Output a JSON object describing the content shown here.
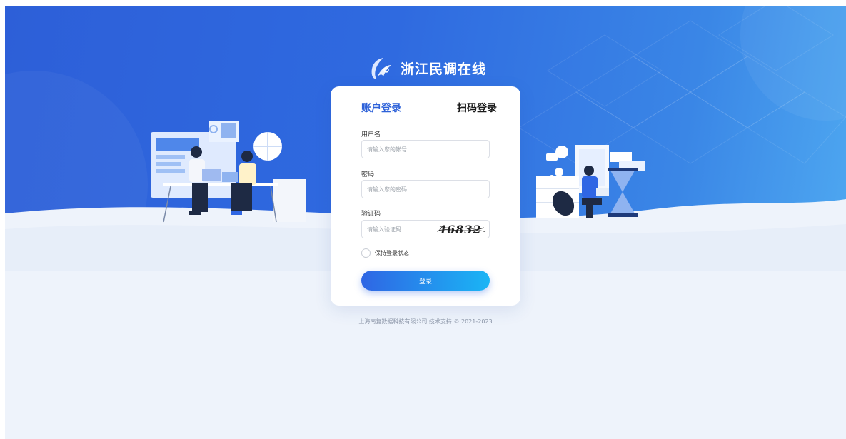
{
  "brand": {
    "name": "浙江民调在线",
    "logo_icon": "crescent-swoosh-logo-icon"
  },
  "tabs": {
    "account": "账户登录",
    "scan": "扫码登录"
  },
  "form": {
    "username_label": "用户名",
    "username_placeholder": "请输入您的帐号",
    "password_label": "密码",
    "password_placeholder": "请输入您的密码",
    "captcha_label": "验证码",
    "captcha_placeholder": "请输入验证码",
    "captcha_text": "46832",
    "remember_label": "保持登录状态",
    "submit_label": "登录"
  },
  "footer": {
    "text": "上海南复数据科技有限公司 技术支持 © 2021-2023"
  },
  "colors": {
    "hero_blue": "#2d5fd8",
    "accent": "#2e62d9",
    "button_start": "#2f66e4",
    "button_end": "#1ab5f5",
    "page_bg": "#eef3fb"
  }
}
